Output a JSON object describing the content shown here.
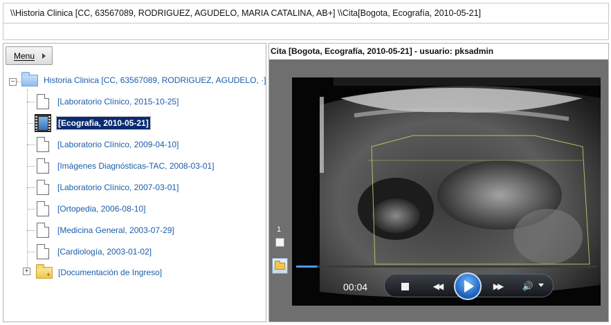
{
  "header": {
    "path": "\\\\Historia Clinica [CC, 63567089, RODRIGUEZ, AGUDELO, MARIA CATALINA, AB+] \\\\Cita[Bogota, Ecografía, 2010-05-21]"
  },
  "menu": {
    "label": "Menu"
  },
  "tree": {
    "root_label": "Historia Clinica [CC, 63567089, RODRIGUEZ, AGUDELO, ·]",
    "items": [
      {
        "label": "[Laboratorio Clínico, 2015-10-25]",
        "icon": "document-icon"
      },
      {
        "label": "[Ecografia, 2010-05-21]",
        "icon": "film-icon",
        "selected": true
      },
      {
        "label": "[Laboratorio Clínico, 2009-04-10]",
        "icon": "document-icon"
      },
      {
        "label": "[Imágenes Diagnósticas-TAC, 2008-03-01]",
        "icon": "document-icon"
      },
      {
        "label": "[Laboratorio Clínico, 2007-03-01]",
        "icon": "document-icon"
      },
      {
        "label": "[Ortopedia, 2006-08-10]",
        "icon": "document-icon"
      },
      {
        "label": "[Medicina General, 2003-07-29]",
        "icon": "document-icon"
      },
      {
        "label": "[Cardiología, 2003-01-02]",
        "icon": "document-icon"
      }
    ],
    "folder_label": "[Documentación de Ingreso]"
  },
  "viewer": {
    "title": "Cita [Bogota, Ecografía, 2010-05-21] - usuario: pksadmin",
    "page_number": "1",
    "time": "00:04",
    "progress_fraction": 0.07
  },
  "colors": {
    "link": "#1a5da8",
    "selected_bg": "#0a2b72",
    "viewer_bg": "#6f6f6f",
    "play_accent": "#1b5db8"
  }
}
